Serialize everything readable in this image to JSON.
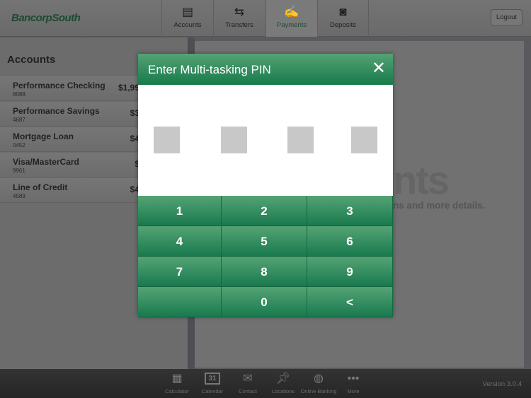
{
  "header": {
    "logo": "BancorpSouth",
    "tabs": [
      {
        "label": "Accounts",
        "icon": "wallet-icon"
      },
      {
        "label": "Transfers",
        "icon": "arrows-icon"
      },
      {
        "label": "Payments",
        "icon": "check-pen-icon",
        "active": true
      },
      {
        "label": "Deposits",
        "icon": "camera-icon"
      }
    ],
    "logout": "Logout"
  },
  "sidebar": {
    "title": "Accounts",
    "accounts": [
      {
        "name": "Performance Checking",
        "number": "8088",
        "balance": "$1,99"
      },
      {
        "name": "Performance Savings",
        "number": "4687",
        "balance": "$3"
      },
      {
        "name": "Mortgage Loan",
        "number": "0452",
        "balance": "$4"
      },
      {
        "name": "Visa/MasterCard",
        "number": "9961",
        "balance": "$"
      },
      {
        "name": "Line of Credit",
        "number": "4589",
        "balance": "$4"
      }
    ]
  },
  "content": {
    "heading_fragment": "nts",
    "subtext_fragment": "ns and more details."
  },
  "modal": {
    "title": "Enter Multi-tasking PIN",
    "close": "✕",
    "pin_length": 4,
    "keys": [
      "1",
      "2",
      "3",
      "4",
      "5",
      "6",
      "7",
      "8",
      "9",
      "",
      "0",
      "<"
    ]
  },
  "footer": {
    "items": [
      {
        "label": "Calculator",
        "icon": "calculator-icon"
      },
      {
        "label": "Calendar",
        "icon": "calendar-icon",
        "day": "31"
      },
      {
        "label": "Contact",
        "icon": "envelope-icon"
      },
      {
        "label": "Locations",
        "icon": "pushpin-icon"
      },
      {
        "label": "Online Banking",
        "icon": "globe-icon"
      },
      {
        "label": "More",
        "icon": "more-icon"
      }
    ],
    "version": "Version 3.0.4"
  },
  "colors": {
    "brand_green": "#187a4e",
    "overlay_gray": "#6c6c6c"
  }
}
